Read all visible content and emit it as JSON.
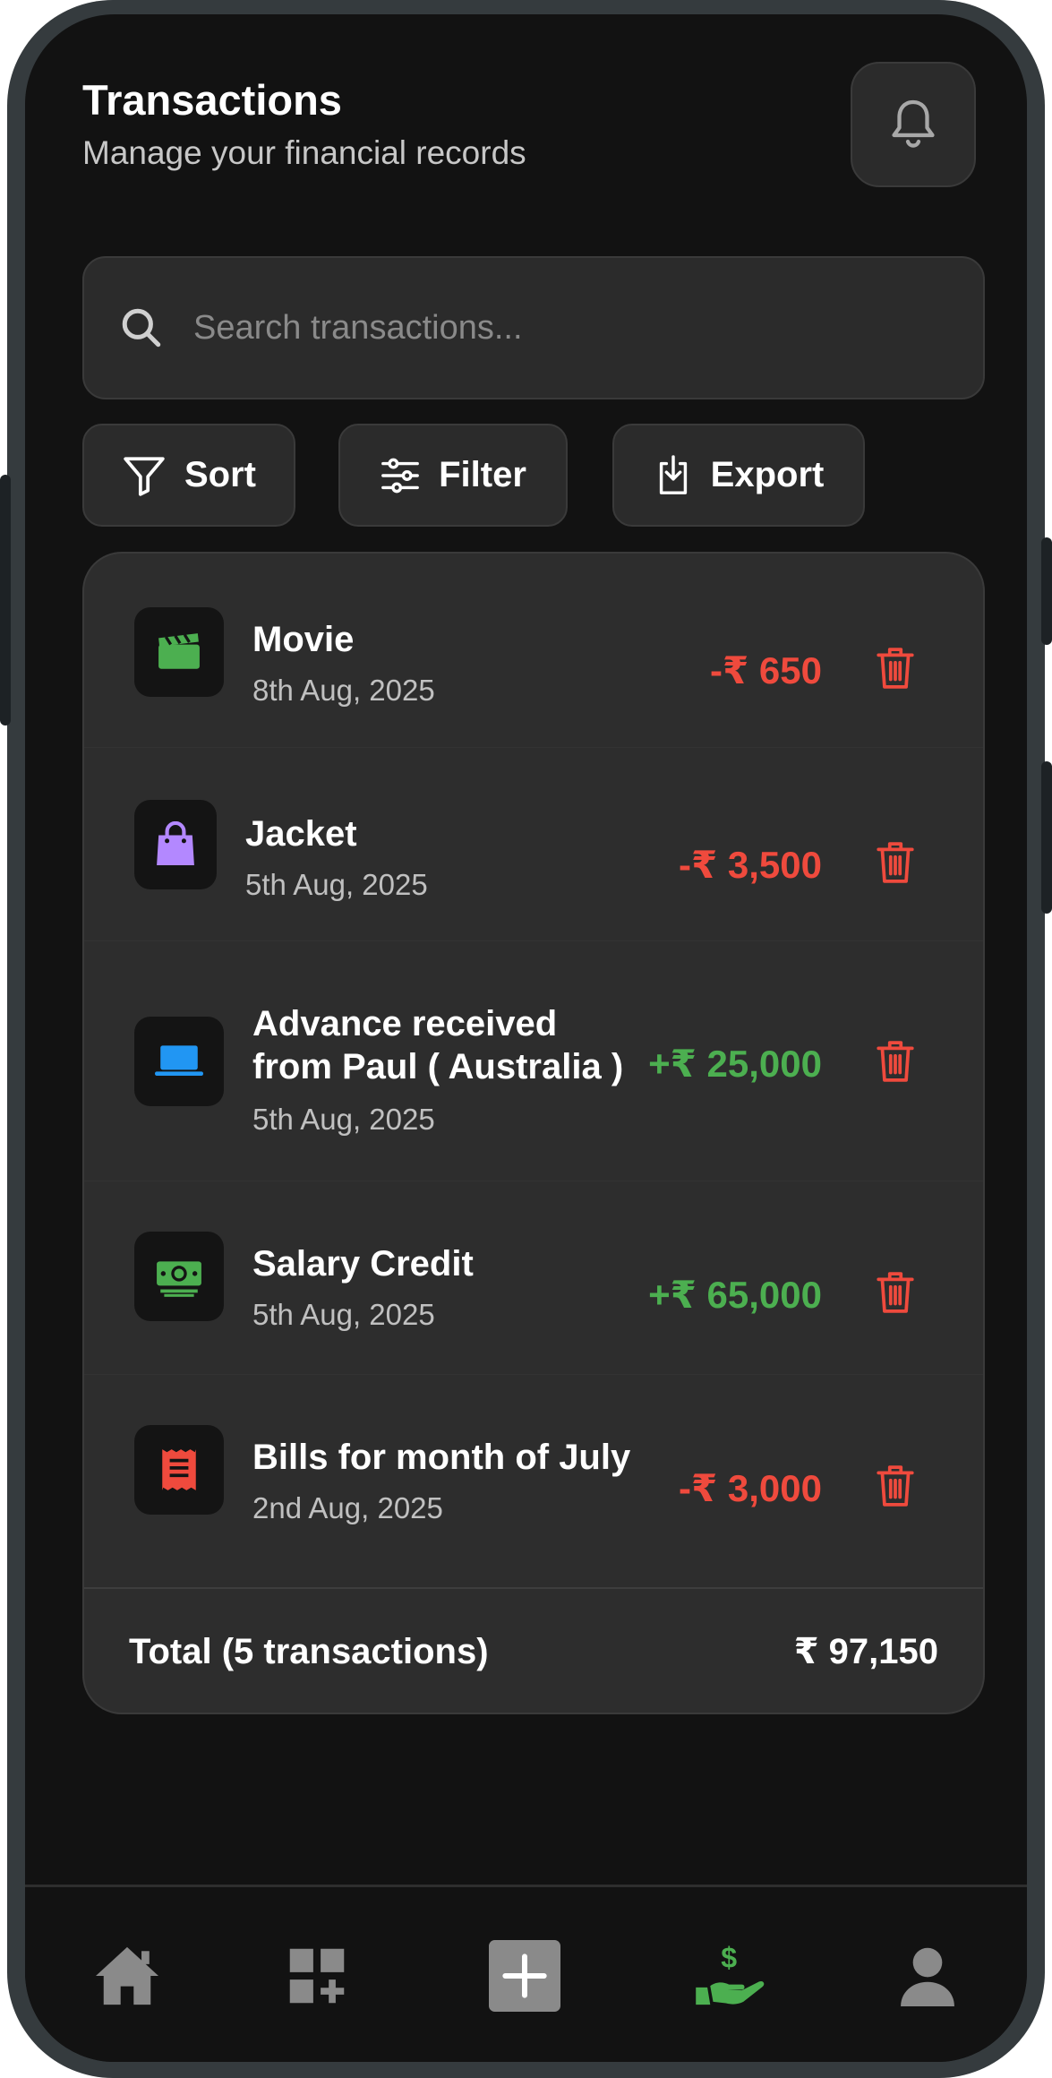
{
  "header": {
    "title": "Transactions",
    "subtitle": "Manage your financial records",
    "bell_icon": "bell-icon"
  },
  "search": {
    "placeholder": "Search transactions...",
    "value": "",
    "icon": "search-icon"
  },
  "actions": [
    {
      "label": "Sort",
      "icon": "funnel-icon"
    },
    {
      "label": "Filter",
      "icon": "sliders-icon"
    },
    {
      "label": "Export",
      "icon": "download-icon"
    }
  ],
  "transactions": [
    {
      "name": "Movie",
      "date": "8th Aug, 2025",
      "amount": "-₹ 650",
      "type": "debit",
      "icon": "clapperboard-icon",
      "icon_color": "#4caf50"
    },
    {
      "name": "Jacket",
      "date": "5th Aug, 2025",
      "amount": "-₹ 3,500",
      "type": "debit",
      "icon": "shopping-bag-icon",
      "icon_color": "#b388ff"
    },
    {
      "name": "Advance received from Paul ( Australia )",
      "date": "5th Aug, 2025",
      "amount": "+₹ 25,000",
      "type": "credit",
      "icon": "laptop-icon",
      "icon_color": "#2196f3"
    },
    {
      "name": "Salary Credit",
      "date": "5th Aug, 2025",
      "amount": "+₹ 65,000",
      "type": "credit",
      "icon": "money-icon",
      "icon_color": "#4caf50"
    },
    {
      "name": "Bills for month of July",
      "date": "2nd Aug, 2025",
      "amount": "-₹ 3,000",
      "type": "debit",
      "icon": "receipt-icon",
      "icon_color": "#ef4a3d"
    }
  ],
  "total": {
    "label": "Total (5 transactions)",
    "value": "₹ 97,150"
  },
  "bottom_nav": [
    {
      "icon": "home-icon",
      "active": false
    },
    {
      "icon": "grid-add-icon",
      "active": false
    },
    {
      "icon": "plus-icon",
      "active": false
    },
    {
      "icon": "hand-dollar-icon",
      "active": true
    },
    {
      "icon": "user-icon",
      "active": false
    }
  ],
  "colors": {
    "background": "#121212",
    "card": "#2d2d2d",
    "debit": "#ef4a3d",
    "credit": "#4caf50",
    "nav_active": "#4caf50",
    "nav_inactive": "#8a8a8a"
  }
}
